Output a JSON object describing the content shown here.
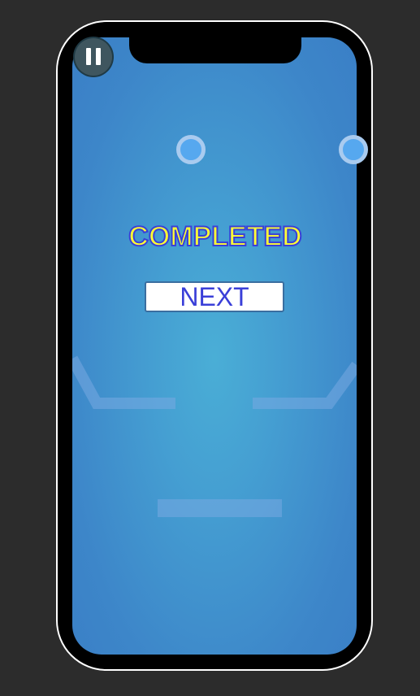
{
  "game": {
    "status_text": "COMPLETED",
    "next_label": "NEXT",
    "pause_icon": "pause-icon"
  },
  "colors": {
    "background": "#2c2c2c",
    "screen_center": "#4aaed6",
    "screen_edge": "#3a7fc6",
    "title_fill": "#ffff33",
    "title_stroke": "#3a3fd8",
    "button_text": "#3a3fd8",
    "ball_fill": "#56a8ef",
    "ball_ring": "#a9cbef"
  }
}
